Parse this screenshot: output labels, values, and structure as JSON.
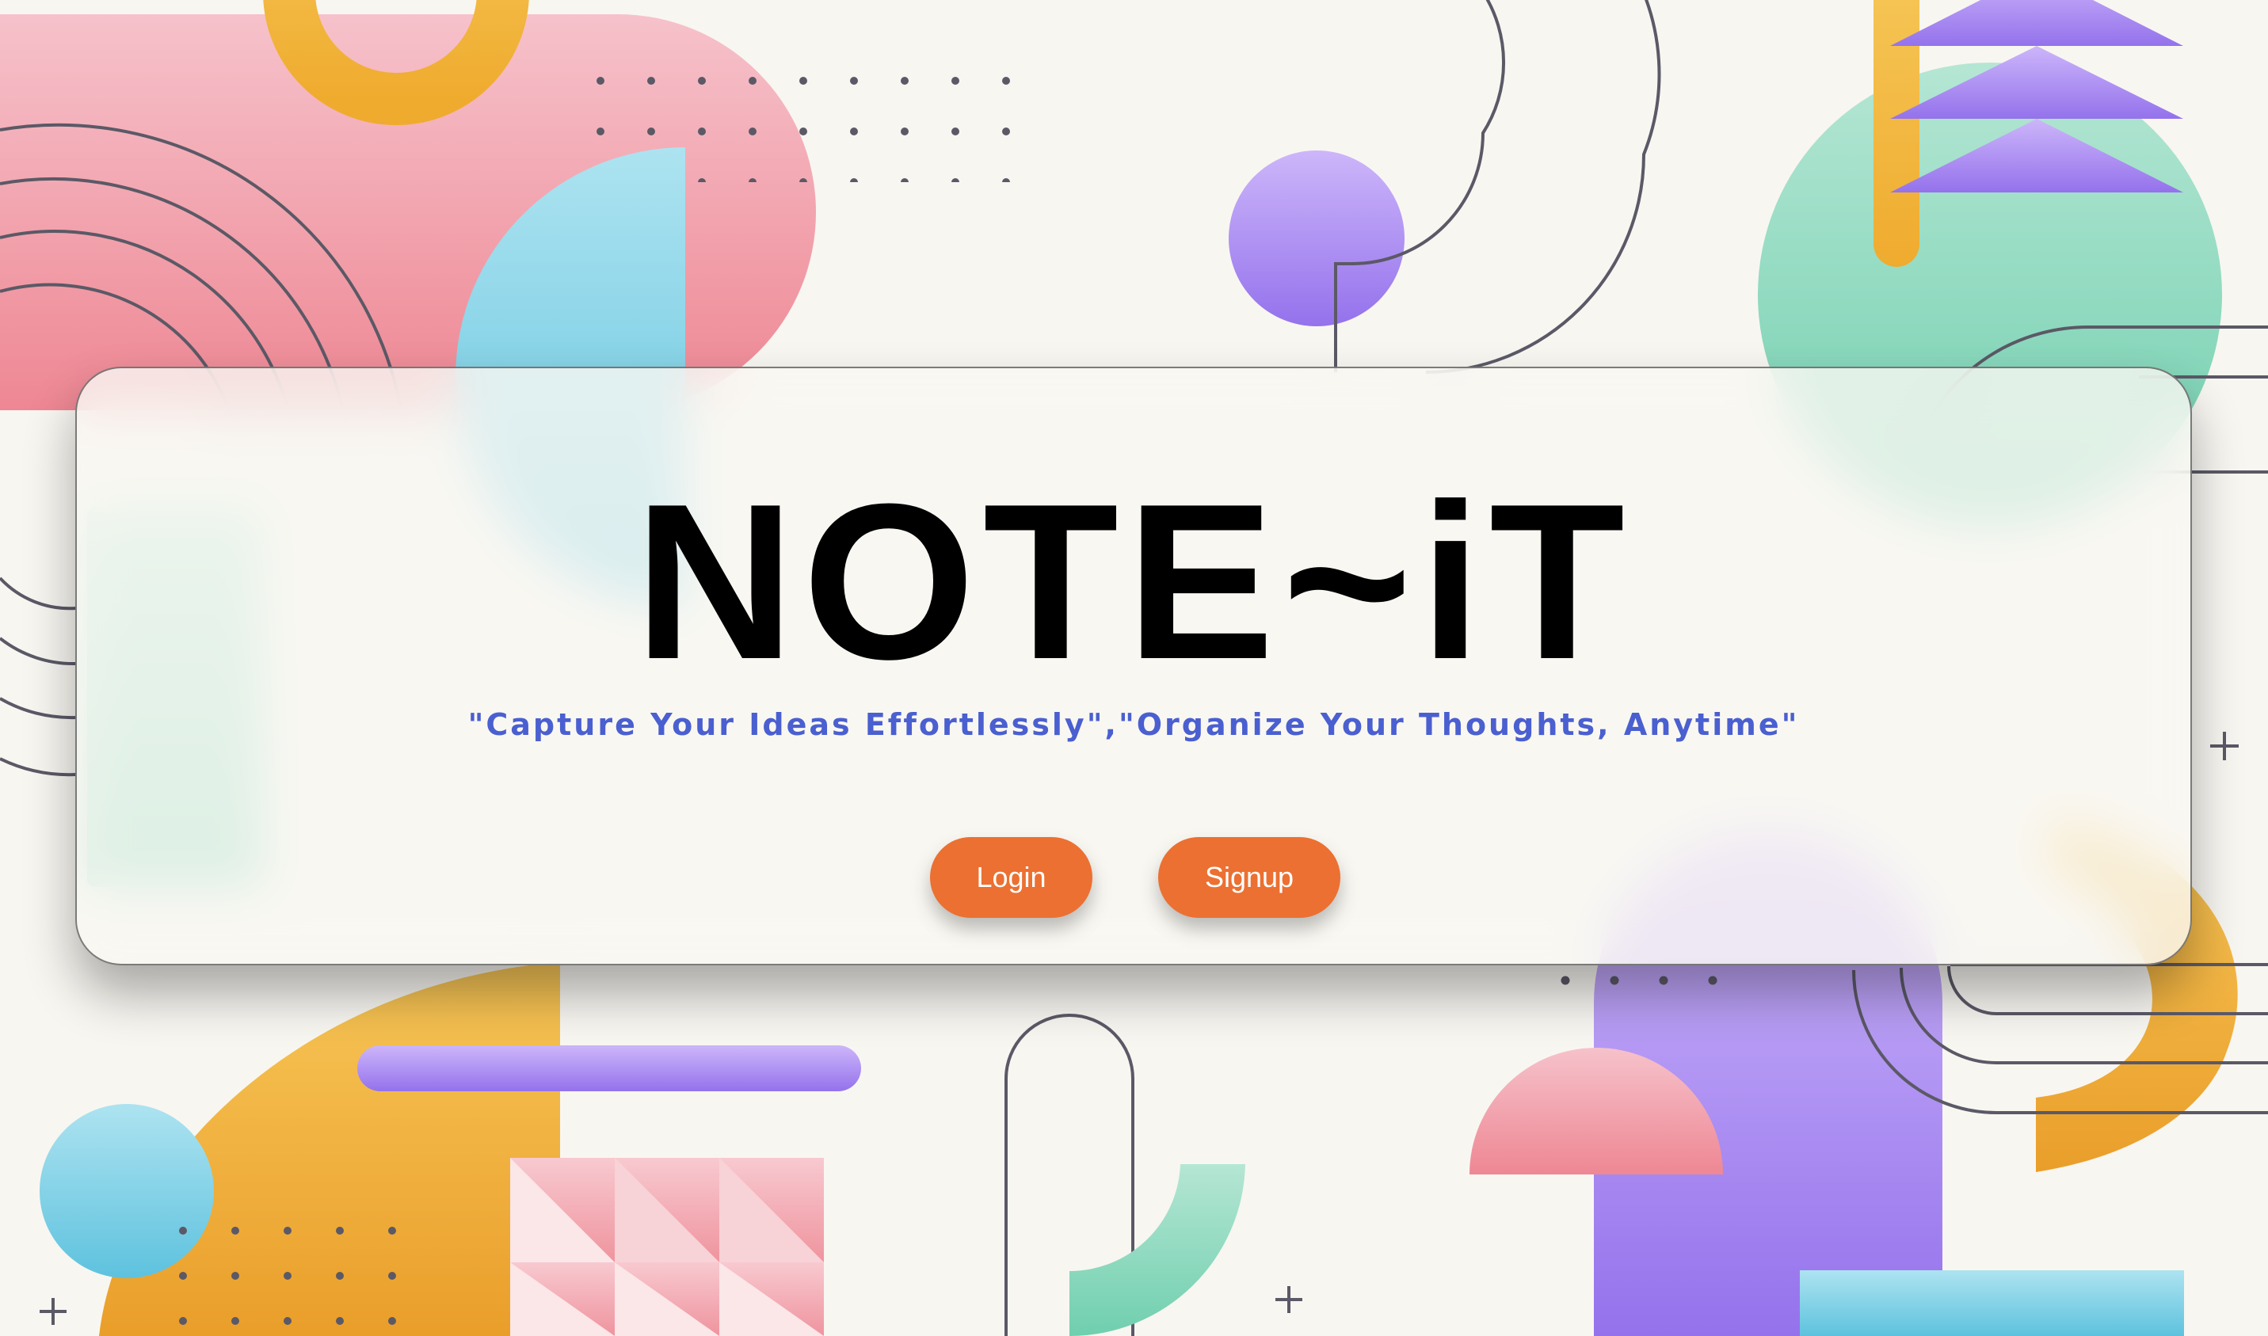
{
  "hero": {
    "title": "NOTE~iT",
    "tagline": "\"Capture Your Ideas Effortlessly\",\"Organize Your Thoughts, Anytime\""
  },
  "actions": {
    "login_label": "Login",
    "signup_label": "Signup"
  },
  "colors": {
    "background": "#f8f6f1",
    "button": "#ec7031",
    "tagline": "#4a5fd0",
    "pink": "#f18f99",
    "blue": "#7fd0e6",
    "green": "#7dd4b4",
    "purple": "#9b74e8",
    "yellow": "#f2b13a",
    "line": "#5b5966"
  },
  "decorations": {
    "style": "abstract geometric background",
    "icons": [
      "plus-icon",
      "dot-grid",
      "half-circle",
      "semi-arch",
      "triangle-stack"
    ]
  }
}
